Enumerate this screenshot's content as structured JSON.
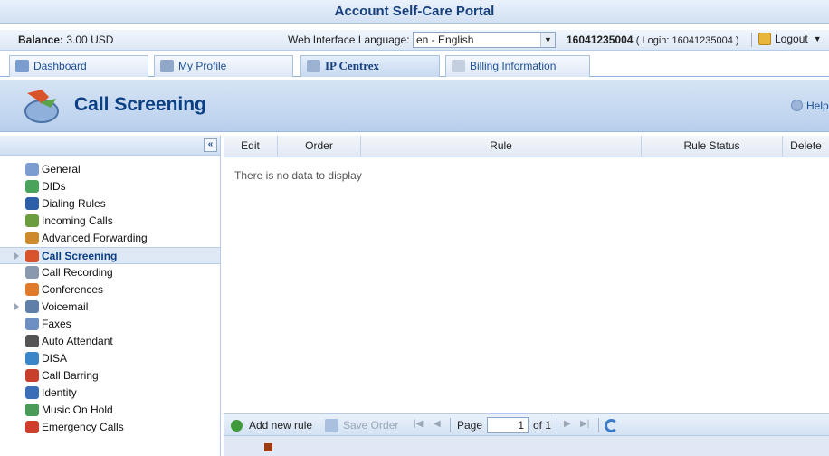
{
  "app": {
    "title": "Account Self-Care Portal"
  },
  "infobar": {
    "balance_label": "Balance:",
    "balance_value": "3.00 USD",
    "language_label": "Web Interface Language:",
    "language_value": "en - English",
    "account_number": "16041235004",
    "account_login": "( Login: 16041235004 )",
    "logout_label": "Logout"
  },
  "tabs": [
    {
      "label": "Dashboard",
      "icon": "dashboard-icon",
      "active": false
    },
    {
      "label": "My Profile",
      "icon": "profile-icon",
      "active": false
    },
    {
      "label": "IP Centrex",
      "icon": "ip-centrex-icon",
      "active": true
    },
    {
      "label": "Billing Information",
      "icon": "billing-icon",
      "active": false
    }
  ],
  "header": {
    "title": "Call Screening",
    "help_label": "Help"
  },
  "sidebar": {
    "collapse_label": "«",
    "items": [
      {
        "label": "General",
        "icon": "gear-icon",
        "color": "#7a9ccf"
      },
      {
        "label": "DIDs",
        "icon": "dids-icon",
        "color": "#4aa35a"
      },
      {
        "label": "Dialing Rules",
        "icon": "dialpad-icon",
        "color": "#2d5ea8"
      },
      {
        "label": "Incoming Calls",
        "icon": "incoming-call-icon",
        "color": "#6b9d3e"
      },
      {
        "label": "Advanced Forwarding",
        "icon": "forwarding-icon",
        "color": "#cc8a2a"
      },
      {
        "label": "Call Screening",
        "icon": "call-screening-icon",
        "color": "#d9542b",
        "active": true
      },
      {
        "label": "Call Recording",
        "icon": "recording-icon",
        "color": "#8a98ad"
      },
      {
        "label": "Conferences",
        "icon": "conference-icon",
        "color": "#e07a2a"
      },
      {
        "label": "Voicemail",
        "icon": "voicemail-icon",
        "color": "#5f7fa8"
      },
      {
        "label": "Faxes",
        "icon": "fax-icon",
        "color": "#6d8fc1"
      },
      {
        "label": "Auto Attendant",
        "icon": "auto-attendant-icon",
        "color": "#555555"
      },
      {
        "label": "DISA",
        "icon": "disa-icon",
        "color": "#3a86c8"
      },
      {
        "label": "Call Barring",
        "icon": "call-barring-icon",
        "color": "#c8402b"
      },
      {
        "label": "Identity",
        "icon": "identity-icon",
        "color": "#3a6fb7"
      },
      {
        "label": "Music On Hold",
        "icon": "music-icon",
        "color": "#4a9a58"
      },
      {
        "label": "Emergency Calls",
        "icon": "emergency-icon",
        "color": "#d03d2a"
      }
    ]
  },
  "grid": {
    "columns": [
      "Edit",
      "Order",
      "Rule",
      "Rule Status",
      "Delete"
    ],
    "empty_message": "There is no data to display"
  },
  "pager": {
    "add_label": "Add new rule",
    "save_order_label": "Save Order",
    "page_label": "Page",
    "page_value": "1",
    "of_label": "of 1"
  }
}
